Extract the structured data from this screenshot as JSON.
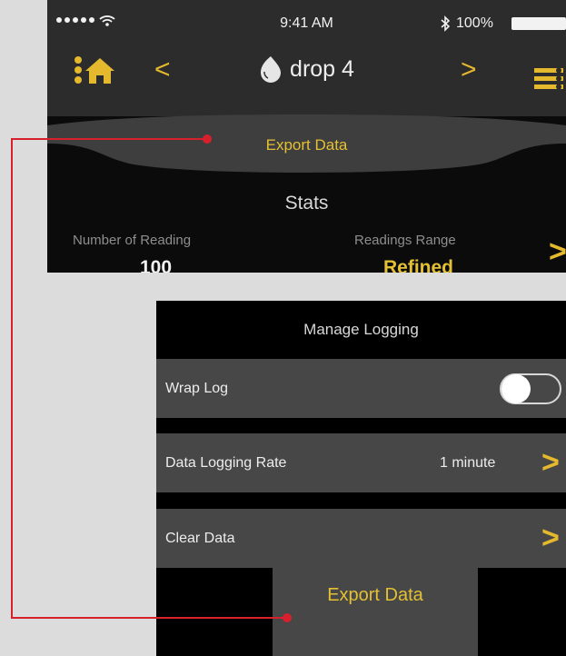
{
  "status_bar": {
    "time": "9:41 AM",
    "battery": "100%"
  },
  "nav": {
    "title": "drop 4",
    "prev_label": "<",
    "next_label": ">"
  },
  "top_sheet": {
    "export_tab": "Export Data",
    "stats_title": "Stats",
    "number_of_reading_label": "Number of Reading",
    "number_of_reading_value": "100",
    "readings_range_label": "Readings Range",
    "readings_range_value": "Refined"
  },
  "logging": {
    "title": "Manage Logging",
    "rows": [
      {
        "label": "Wrap Log",
        "toggle_on": false
      },
      {
        "label": "Data Logging Rate",
        "value": "1 minute"
      },
      {
        "label": "Clear Data"
      }
    ],
    "export_button": "Export Data"
  },
  "colors": {
    "accent": "#e4b92d",
    "callout_line": "#d8202c",
    "nav_bg": "#2c2c2c",
    "row_bg": "#474747"
  },
  "icons": [
    "signal-dots-icon",
    "wifi-icon",
    "bluetooth-icon",
    "battery-icon",
    "home-icon",
    "drop-icon",
    "menu-icon",
    "chevron-right-icon"
  ]
}
